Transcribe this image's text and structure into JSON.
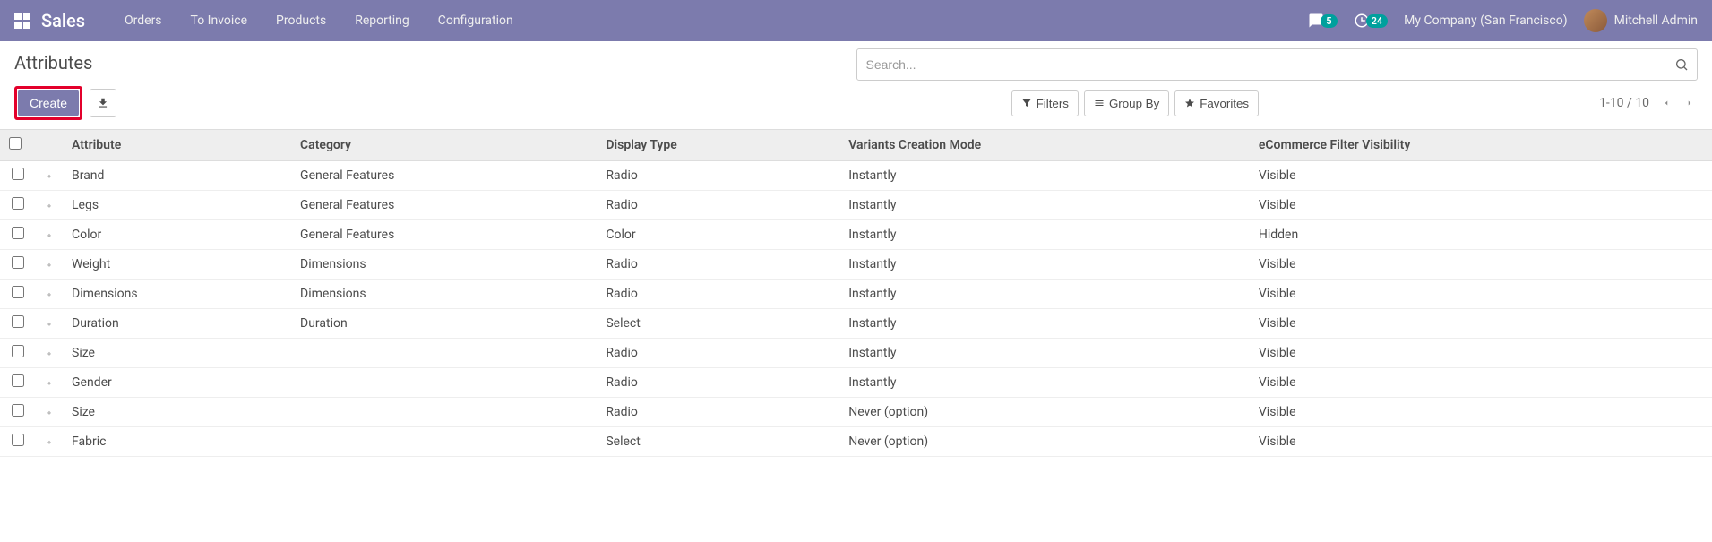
{
  "nav": {
    "brand": "Sales",
    "items": [
      "Orders",
      "To Invoice",
      "Products",
      "Reporting",
      "Configuration"
    ],
    "messages_badge": "5",
    "activities_badge": "24",
    "company": "My Company (San Francisco)",
    "user": "Mitchell Admin"
  },
  "page": {
    "title": "Attributes",
    "create_label": "Create",
    "search_placeholder": "Search...",
    "filters_label": "Filters",
    "groupby_label": "Group By",
    "favorites_label": "Favorites",
    "pager": "1-10 / 10"
  },
  "columns": {
    "attribute": "Attribute",
    "category": "Category",
    "display_type": "Display Type",
    "variants_mode": "Variants Creation Mode",
    "ecommerce_vis": "eCommerce Filter Visibility"
  },
  "rows": [
    {
      "attribute": "Brand",
      "category": "General Features",
      "display_type": "Radio",
      "variants_mode": "Instantly",
      "ecommerce_vis": "Visible"
    },
    {
      "attribute": "Legs",
      "category": "General Features",
      "display_type": "Radio",
      "variants_mode": "Instantly",
      "ecommerce_vis": "Visible"
    },
    {
      "attribute": "Color",
      "category": "General Features",
      "display_type": "Color",
      "variants_mode": "Instantly",
      "ecommerce_vis": "Hidden"
    },
    {
      "attribute": "Weight",
      "category": "Dimensions",
      "display_type": "Radio",
      "variants_mode": "Instantly",
      "ecommerce_vis": "Visible"
    },
    {
      "attribute": "Dimensions",
      "category": "Dimensions",
      "display_type": "Radio",
      "variants_mode": "Instantly",
      "ecommerce_vis": "Visible"
    },
    {
      "attribute": "Duration",
      "category": "Duration",
      "display_type": "Select",
      "variants_mode": "Instantly",
      "ecommerce_vis": "Visible"
    },
    {
      "attribute": "Size",
      "category": "",
      "display_type": "Radio",
      "variants_mode": "Instantly",
      "ecommerce_vis": "Visible"
    },
    {
      "attribute": "Gender",
      "category": "",
      "display_type": "Radio",
      "variants_mode": "Instantly",
      "ecommerce_vis": "Visible"
    },
    {
      "attribute": "Size",
      "category": "",
      "display_type": "Radio",
      "variants_mode": "Never (option)",
      "ecommerce_vis": "Visible"
    },
    {
      "attribute": "Fabric",
      "category": "",
      "display_type": "Select",
      "variants_mode": "Never (option)",
      "ecommerce_vis": "Visible"
    }
  ]
}
